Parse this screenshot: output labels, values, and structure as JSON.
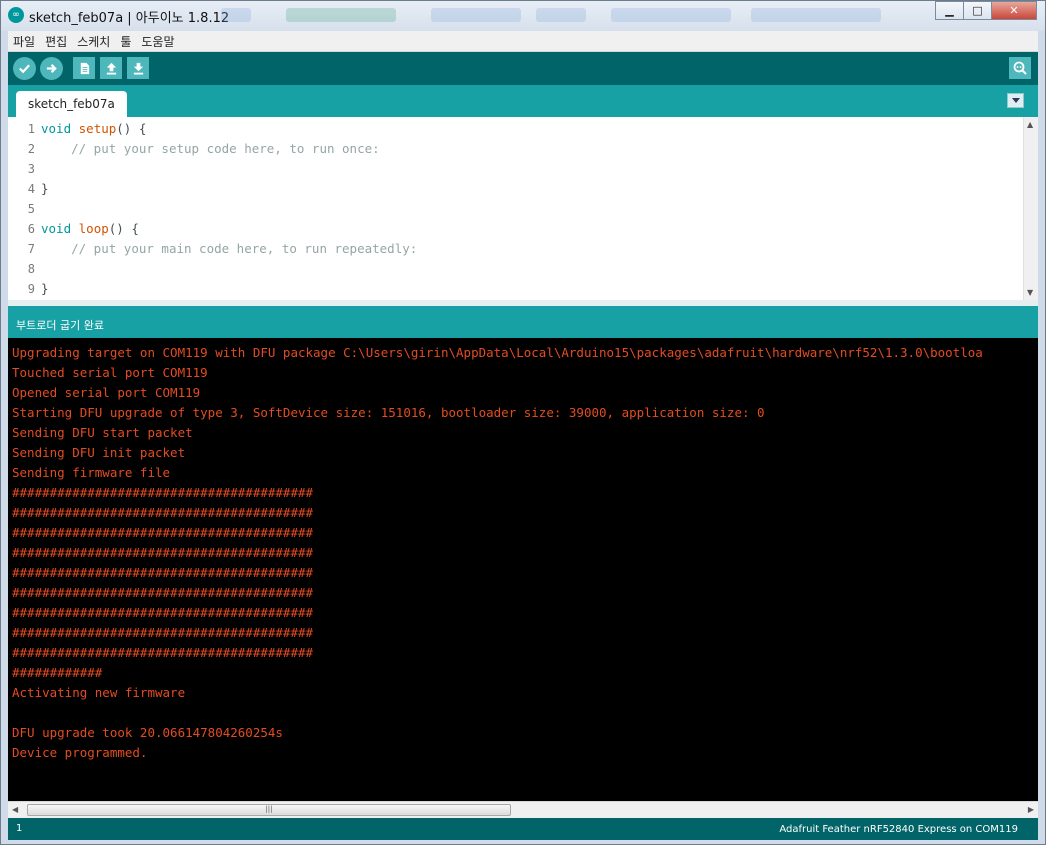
{
  "window": {
    "title": "sketch_feb07a | 아두이노 1.8.12",
    "app_icon": "arduino-infinity-icon",
    "controls": [
      "minimize",
      "maximize",
      "close"
    ]
  },
  "menu": [
    "파일",
    "편집",
    "스케치",
    "툴",
    "도움말"
  ],
  "toolbar": {
    "buttons": [
      "verify-icon",
      "upload-icon",
      "new-icon",
      "open-icon",
      "save-icon"
    ],
    "right_button": "serial-monitor-icon"
  },
  "tabs": [
    {
      "label": "sketch_feb07a",
      "active": true
    }
  ],
  "editor": {
    "lines": [
      {
        "n": "1",
        "type": "void",
        "fn": "setup",
        "rest": "() {",
        "indent": "",
        "comment": ""
      },
      {
        "n": "2",
        "type": "",
        "fn": "",
        "rest": "",
        "indent": "    ",
        "comment": "// put your setup code here, to run once:"
      },
      {
        "n": "3",
        "type": "",
        "fn": "",
        "rest": "",
        "indent": "",
        "comment": ""
      },
      {
        "n": "4",
        "type": "",
        "fn": "",
        "rest": "}",
        "indent": "",
        "comment": ""
      },
      {
        "n": "5",
        "type": "",
        "fn": "",
        "rest": "",
        "indent": "",
        "comment": ""
      },
      {
        "n": "6",
        "type": "void",
        "fn": "loop",
        "rest": "() {",
        "indent": "",
        "comment": ""
      },
      {
        "n": "7",
        "type": "",
        "fn": "",
        "rest": "",
        "indent": "    ",
        "comment": "// put your main code here, to run repeatedly:"
      },
      {
        "n": "8",
        "type": "",
        "fn": "",
        "rest": "",
        "indent": "",
        "comment": ""
      },
      {
        "n": "9",
        "type": "",
        "fn": "",
        "rest": "}",
        "indent": "",
        "comment": ""
      }
    ]
  },
  "status": {
    "message": "부트로더 굽기 완료"
  },
  "console": {
    "lines": [
      "Upgrading target on COM119 with DFU package C:\\Users\\girin\\AppData\\Local\\Arduino15\\packages\\adafruit\\hardware\\nrf52\\1.3.0\\bootloa",
      "Touched serial port COM119",
      "Opened serial port COM119",
      "Starting DFU upgrade of type 3, SoftDevice size: 151016, bootloader size: 39000, application size: 0",
      "Sending DFU start packet",
      "Sending DFU init packet",
      "Sending firmware file",
      "########################################",
      "########################################",
      "########################################",
      "########################################",
      "########################################",
      "########################################",
      "########################################",
      "########################################",
      "########################################",
      "############",
      "Activating new firmware",
      "",
      "DFU upgrade took 20.066147804260254s",
      "Device programmed."
    ]
  },
  "footer": {
    "line_number": "1",
    "board": "Adafruit Feather nRF52840 Express on COM119"
  },
  "colors": {
    "toolbar": "#006468",
    "accent": "#17a1a5",
    "console_text": "#e34c22"
  }
}
